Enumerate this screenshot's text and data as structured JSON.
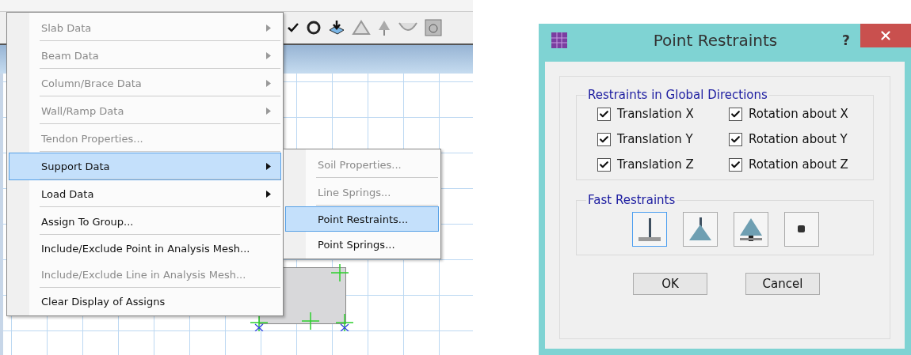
{
  "menu": {
    "items": [
      {
        "label": "Slab Data",
        "kind": "submenu",
        "disabled": true,
        "selected": false,
        "group_end": true
      },
      {
        "label": "Beam Data",
        "kind": "submenu",
        "disabled": true,
        "selected": false,
        "group_end": true
      },
      {
        "label": "Column/Brace Data",
        "kind": "submenu",
        "disabled": true,
        "selected": false,
        "group_end": true
      },
      {
        "label": "Wall/Ramp Data",
        "kind": "submenu",
        "disabled": true,
        "selected": false,
        "group_end": true
      },
      {
        "label": "Tendon Properties...",
        "kind": "command",
        "disabled": true,
        "selected": false,
        "group_end": true
      },
      {
        "label": "Support Data",
        "kind": "submenu",
        "disabled": false,
        "selected": true,
        "group_end": true
      },
      {
        "label": "Load Data",
        "kind": "submenu",
        "disabled": false,
        "selected": false,
        "group_end": true
      },
      {
        "label": "Assign To Group...",
        "kind": "command",
        "disabled": false,
        "selected": false,
        "group_end": true
      },
      {
        "label": "Include/Exclude Point in Analysis Mesh...",
        "kind": "command",
        "disabled": false,
        "selected": false,
        "group_end": false
      },
      {
        "label": "Include/Exclude Line in Analysis Mesh...",
        "kind": "command",
        "disabled": true,
        "selected": false,
        "group_end": true
      },
      {
        "label": "Clear Display of Assigns",
        "kind": "command",
        "disabled": false,
        "selected": false,
        "group_end": false
      }
    ]
  },
  "submenu": {
    "items": [
      {
        "label": "Soil Properties...",
        "disabled": true,
        "selected": false,
        "group_end": true
      },
      {
        "label": "Line Springs...",
        "disabled": true,
        "selected": false,
        "group_end": true
      },
      {
        "label": "Point Restraints...",
        "disabled": false,
        "selected": true,
        "group_end": false
      },
      {
        "label": "Point Springs...",
        "disabled": false,
        "selected": false,
        "group_end": false
      }
    ]
  },
  "dialog": {
    "title": "Point Restraints",
    "help": "?",
    "restraints": {
      "title": "Restraints in Global Directions",
      "checkboxes": [
        {
          "label": "Translation X",
          "checked": true
        },
        {
          "label": "Rotation about X",
          "checked": true
        },
        {
          "label": "Translation Y",
          "checked": true
        },
        {
          "label": "Rotation about Y",
          "checked": true
        },
        {
          "label": "Translation Z",
          "checked": true
        },
        {
          "label": "Rotation about Z",
          "checked": true
        }
      ]
    },
    "fast_restraints": {
      "title": "Fast Restraints",
      "buttons": [
        {
          "kind": "fixed",
          "selected": true
        },
        {
          "kind": "pinned",
          "selected": false
        },
        {
          "kind": "roller",
          "selected": false
        },
        {
          "kind": "free",
          "selected": false
        }
      ]
    },
    "buttons": [
      "OK",
      "Cancel"
    ]
  }
}
